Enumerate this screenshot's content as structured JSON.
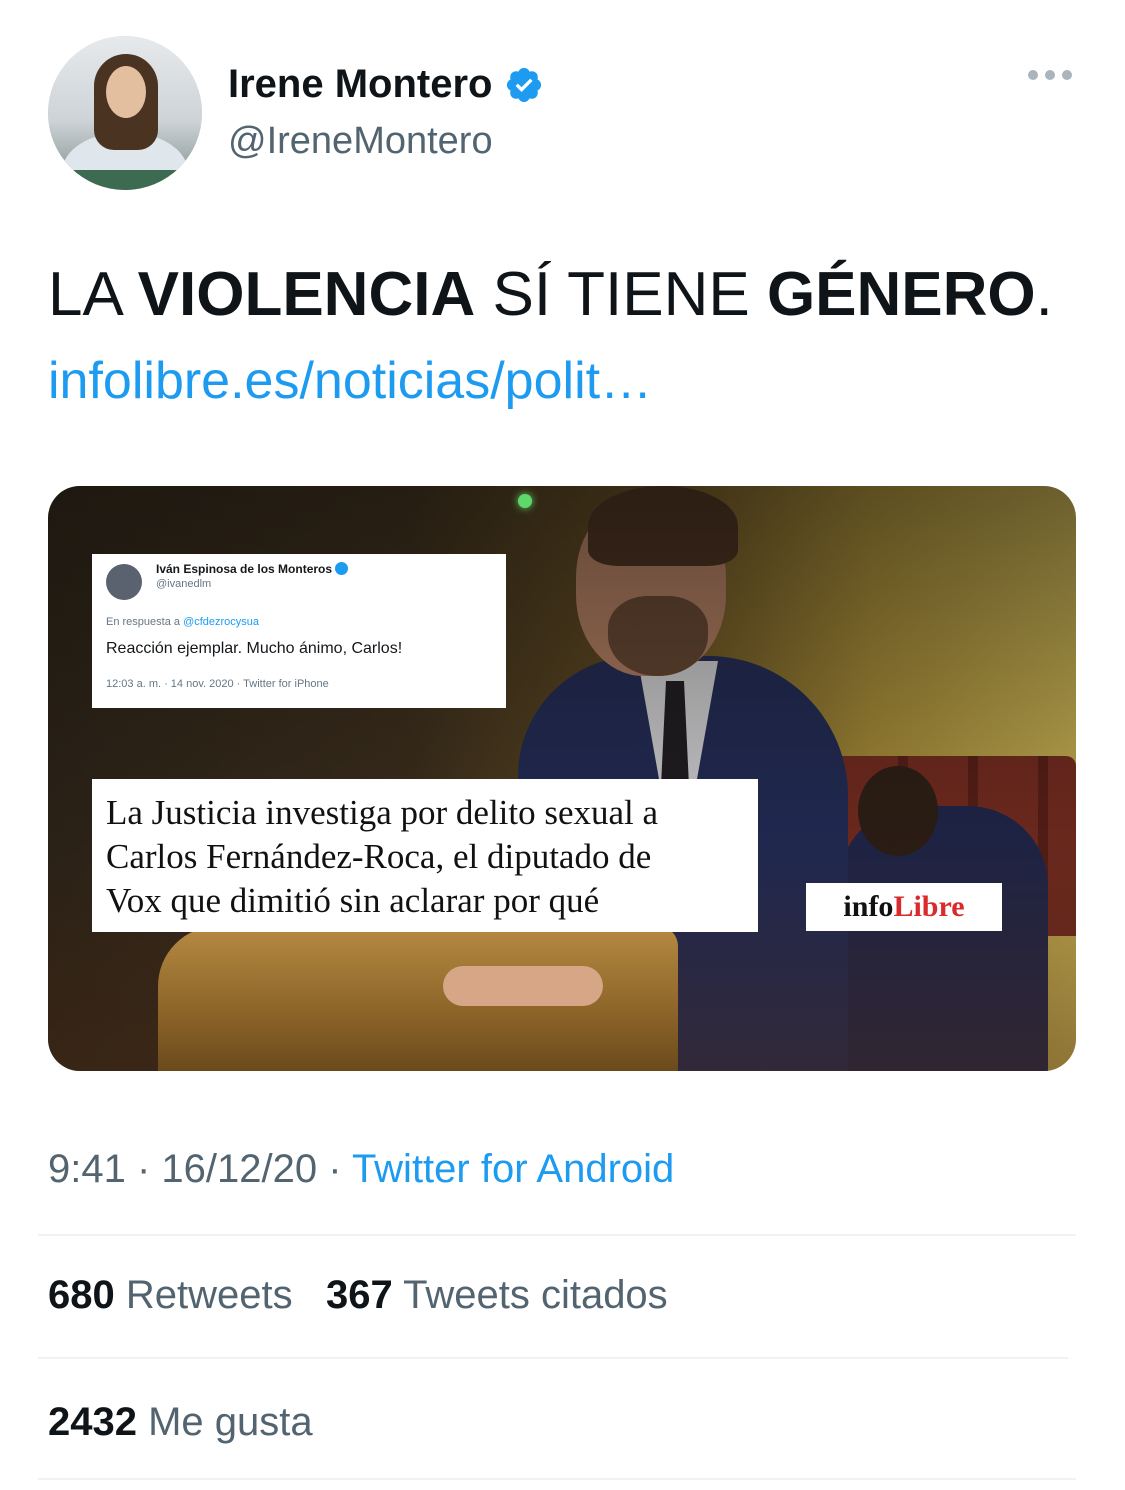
{
  "author": {
    "name": "Irene Montero",
    "handle": "@IreneMontero"
  },
  "tweet": {
    "text_parts": [
      "LA ",
      "VIOLENCIA",
      " SÍ TIENE ",
      "GÉNERO",
      "."
    ],
    "link": "infolibre.es/noticias/polit…"
  },
  "media": {
    "embedded_tweet": {
      "name": "Iván Espinosa de los Monteros",
      "handle": "@ivanedlm",
      "reply_prefix": "En respuesta a ",
      "reply_to": "@cfdezrocysua",
      "text": "Reacción ejemplar. Mucho ánimo, Carlos!",
      "meta": "12:03 a. m. · 14 nov. 2020 · Twitter for iPhone"
    },
    "headline_lines": [
      "La Justicia investiga por delito sexual a",
      "Carlos Fernández-Roca, el diputado de",
      "Vox que dimitió sin aclarar por qué"
    ],
    "logo_part1": "info",
    "logo_part2": "Libre"
  },
  "meta": {
    "time": "9:41",
    "date": "16/12/20",
    "separator": " · ",
    "source": "Twitter for Android"
  },
  "stats": {
    "retweets_count": "680",
    "retweets_label": "Retweets",
    "quotes_count": "367",
    "quotes_label": "Tweets citados",
    "likes_count": "2432",
    "likes_label": "Me gusta"
  },
  "colors": {
    "link": "#1d9bf0",
    "secondary_text": "#536471",
    "primary_text": "#0f1419",
    "logo_accent": "#d92b2b"
  },
  "icons": [
    "verified-badge-icon",
    "more-options-icon"
  ]
}
